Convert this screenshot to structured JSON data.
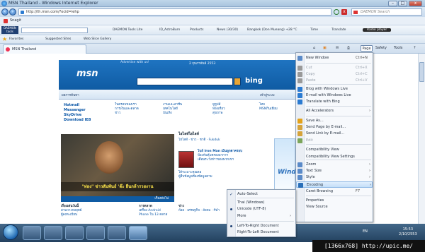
{
  "window": {
    "title": "MSN Thailand - Windows Internet Explorer",
    "min": "–",
    "max": "□",
    "close": "x"
  },
  "address": {
    "url": "http://th.msn.com/?ocid=iehp",
    "search_placeholder": "DAEMON Search"
  },
  "menubar": {
    "items": [
      "Snagit",
      "DAEMON Tools Lite",
      "ID_AstroBurn",
      "Products",
      "News (30/30)",
      "Bangkok (Don Mueang) +28 °C",
      "Time",
      "Translate",
      "Radio player"
    ]
  },
  "favorites": {
    "label": "Favorites",
    "items": [
      "Suggested Sites",
      "Web Slice Gallery"
    ]
  },
  "tab": {
    "title": "MSN Thailand"
  },
  "commandbar": {
    "page": "Page",
    "safety": "Safety",
    "tools": "Tools",
    "help": "?"
  },
  "page": {
    "advertise": "Advertise with us!",
    "date": "2 กุมภาพันธ์ 2553",
    "logo": "msn",
    "bing": "bing",
    "nav": [
      "ผลการค้นหา",
      "เข้าสู่ระบบ"
    ],
    "services": [
      "Hotmail",
      "Messenger",
      "SkyDrive",
      "Download IE8"
    ],
    "col2": [
      "ในครอบของเรา",
      "การเงินและตลาด",
      "ข่าว"
    ],
    "col3": [
      "งานและอาชีพ",
      "เทคโนโลยี",
      "บันเทิง"
    ],
    "col4": [
      "ยูทูปส์",
      "ท่องเที่ยว",
      "สุขภาพ"
    ],
    "col5": [
      "ไทย",
      "MSNกินเยี่ยม"
    ],
    "photo_caption": "\"ท่อง\" ข่าวสัมพันธ์ 'ต๊ะ ยืนกล้ารวยงาน",
    "photo_pager": "เรื่องต่อไป",
    "news_title": "ไฮไลท์ไฮไลท์",
    "news_tabs": [
      "ไฮไลท์",
      "ข่าว",
      "ชาติ",
      "Fukduk"
    ],
    "news_items": [
      "ไบล์ Iron Man เมินลูกตาครอบ",
      "ป้องกันคุ้มครองอาการ",
      "เตือนระวังข่าวของพวกเขา",
      "ได้ระเบาะคุณตอ",
      "ผู้สืบข้อมูลที่ลงข้อมูลตาม"
    ],
    "low_left": [
      "เรื่องเด่นวันนี้",
      "สวนวางกลยุทธ์",
      "ผู้ลงทะเบียน"
    ],
    "low_mid": [
      "การตลาด",
      "เครื่อง Android",
      "Phone ใน 13 คลาส"
    ],
    "low_mid2": [
      "ข่าว",
      "ถ้อย",
      "เศรษฐกิจ",
      "สังคม",
      "กีฬา"
    ]
  },
  "page_menu": {
    "items": [
      {
        "label": "New Window",
        "shortcut": "Ctrl+N",
        "disabled": false
      },
      {
        "label": "Cut",
        "shortcut": "Ctrl+X",
        "disabled": true
      },
      {
        "label": "Copy",
        "shortcut": "Ctrl+C",
        "disabled": true
      },
      {
        "label": "Paste",
        "shortcut": "Ctrl+V",
        "disabled": true
      },
      {
        "label": "Blog with Windows Live",
        "shortcut": "",
        "disabled": false
      },
      {
        "label": "E-mail with Windows Live",
        "shortcut": "",
        "disabled": false
      },
      {
        "label": "Translate with Bing",
        "shortcut": "",
        "disabled": false
      },
      {
        "label": "All Accelerators",
        "shortcut": "",
        "disabled": false,
        "submenu": true
      },
      {
        "label": "Save As...",
        "shortcut": "",
        "disabled": false
      },
      {
        "label": "Send Page by E-mail...",
        "shortcut": "",
        "disabled": false
      },
      {
        "label": "Send Link by E-mail...",
        "shortcut": "",
        "disabled": false
      },
      {
        "label": "Edit",
        "shortcut": "",
        "disabled": true
      },
      {
        "label": "Compatibility View",
        "shortcut": "",
        "disabled": false
      },
      {
        "label": "Compatibility View Settings",
        "shortcut": "",
        "disabled": false
      },
      {
        "label": "Zoom",
        "shortcut": "",
        "disabled": false,
        "submenu": true
      },
      {
        "label": "Text Size",
        "shortcut": "",
        "disabled": false,
        "submenu": true
      },
      {
        "label": "Style",
        "shortcut": "",
        "disabled": false,
        "submenu": true
      },
      {
        "label": "Encoding",
        "shortcut": "",
        "disabled": false,
        "submenu": true,
        "highlighted": true
      },
      {
        "label": "Caret Browsing",
        "shortcut": "F7",
        "disabled": false
      },
      {
        "label": "Properties",
        "shortcut": "",
        "disabled": false
      },
      {
        "label": "View Source",
        "shortcut": "",
        "disabled": false
      }
    ]
  },
  "encoding_menu": {
    "items": [
      {
        "label": "Auto-Select",
        "mark": "check"
      },
      {
        "label": "Thai (Windows)",
        "mark": ""
      },
      {
        "label": "Unicode (UTF-8)",
        "mark": "bullet"
      },
      {
        "label": "More",
        "mark": "",
        "submenu": true
      },
      {
        "label": "Left-To-Right Document",
        "mark": "bullet"
      },
      {
        "label": "Right-To-Left Document",
        "mark": ""
      }
    ]
  },
  "taskbar": {
    "lang": "EN",
    "time": "15:53",
    "date": "2/10/2553"
  },
  "watermark": "[1366x768] http://upic.me/"
}
